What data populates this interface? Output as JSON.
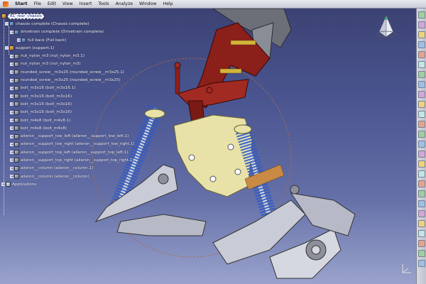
{
  "menu": {
    "items": [
      "Start",
      "File",
      "Edit",
      "View",
      "Insert",
      "Tools",
      "Analyze",
      "Window",
      "Help"
    ]
  },
  "tree": {
    "root": "R1_rear_chassis",
    "chassis": "chassis complete (Chassis complete)",
    "drivetrain": "drivetrain complete (Drivetrain complete)",
    "fullback": "full back (Full back)",
    "support": "support (support.1)",
    "parts": [
      "nut_nylon_m3 (nut_nylon_m3.1)",
      "nut_nylon_m3 (nut_nylon_m3)",
      "rounded_screw__m3x25 (rounded_screw__m3x25.1)",
      "rounded_screw__m3x25 (rounded_screw__m3x25)",
      "bolt_m3x16 (bolt_m3x16.1)",
      "bolt_m3x16 (bolt_m3x16)",
      "bolt_m3x16 (bolt_m3x16)",
      "bolt_m3x16 (bolt_m3x16)",
      "bolt_m4x8 (bolt_m4x8.1)",
      "bolt_m4x8 (bolt_m4x8)",
      "aileron__support_low_left (aileron__support_low_left.1)",
      "aileron__support_low_right (aileron__support_low_right.1)",
      "aileron__support_top_left (aileron__support_top_left.1)",
      "aileron__support_top_right (aileron__support_top_right.1)",
      "aileron__column (aileron__column.1)",
      "aileron__column (aileron__column)"
    ],
    "applications": "Applications"
  },
  "icons": {
    "compass": "compass-icon",
    "axis": "axis-triad-icon"
  },
  "colors": {
    "background_top": "#3a4070",
    "background_bottom": "#9aa3cc",
    "frame_red": "#8b1f1a",
    "plate_yellow": "#e8e2a8",
    "spring_blue": "#2f5bc4",
    "arm_silver": "#c9ccd6"
  }
}
